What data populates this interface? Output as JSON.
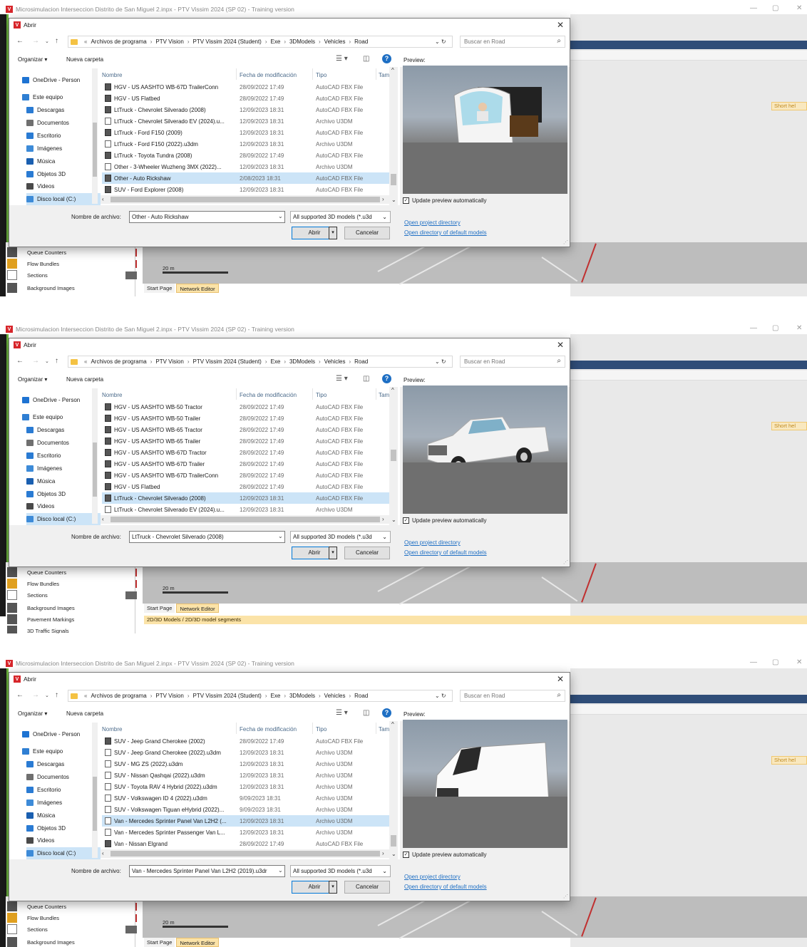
{
  "app": {
    "title": "Microsimulacion Interseccion Distrito de San Miguel 2.inpx - PTV Vissim 2024 (SP 02) - Training version",
    "short_help": "Short hel"
  },
  "dialog": {
    "title": "Abrir",
    "breadcrumb": [
      "Archivos de programa",
      "PTV Vision",
      "PTV Vissim 2024 (Student)",
      "Exe",
      "3DModels",
      "Vehicles",
      "Road"
    ],
    "search_placeholder": "Buscar en Road",
    "organize": "Organizar ▾",
    "new_folder": "Nueva carpeta",
    "preview_label": "Preview:",
    "columns": {
      "name": "Nombre",
      "date": "Fecha de modificación",
      "type": "Tipo",
      "size": "Tam"
    },
    "nav_items": [
      "OneDrive - Person",
      "Este equipo",
      "Descargas",
      "Documentos",
      "Escritorio",
      "Imágenes",
      "Música",
      "Objetos 3D",
      "Videos",
      "Disco local (C:)"
    ],
    "nav_colors": [
      "#1e73d2",
      "#2f7fd3",
      "#2a7bd3",
      "#6f6f6f",
      "#2a7bd3",
      "#3d8bd8",
      "#1a5fb0",
      "#2a7bd3",
      "#4a4a4a",
      "#3d8bd8"
    ],
    "update_preview": "Update preview automatically",
    "filename_label": "Nombre de archivo:",
    "filter": "All supported 3D models (*.u3d",
    "open_btn": "Abrir",
    "cancel_btn": "Cancelar",
    "link1": "Open project directory",
    "link2": "Open directory of default models"
  },
  "background": {
    "left_items": [
      "Queue Counters",
      "Flow Bundles",
      "Sections",
      "Background Images",
      "Pavement Markings",
      "3D Traffic Signals"
    ],
    "scale": "20 m",
    "tabs": [
      "Start Page",
      "Network Editor"
    ],
    "panel_tab": "2D/3D Models / 2D/3D model segments"
  },
  "panels": [
    {
      "filename": "Other - Auto Rickshaw",
      "preview_model": "Auto Rickshaw",
      "files": [
        {
          "name": "HGV - US AASHTO WB-67D TrailerConn",
          "date": "28/09/2022 17:49",
          "type": "AutoCAD FBX File",
          "fbx": true
        },
        {
          "name": "HGV - US Flatbed",
          "date": "28/09/2022 17:49",
          "type": "AutoCAD FBX File",
          "fbx": true
        },
        {
          "name": "LtTruck - Chevrolet Silverado (2008)",
          "date": "12/09/2023 18:31",
          "type": "AutoCAD FBX File",
          "fbx": true
        },
        {
          "name": "LtTruck - Chevrolet Silverado EV (2024).u...",
          "date": "12/09/2023 18:31",
          "type": "Archivo U3DM",
          "fbx": false
        },
        {
          "name": "LtTruck - Ford F150 (2009)",
          "date": "12/09/2023 18:31",
          "type": "AutoCAD FBX File",
          "fbx": true
        },
        {
          "name": "LtTruck - Ford F150 (2022).u3dm",
          "date": "12/09/2023 18:31",
          "type": "Archivo U3DM",
          "fbx": false
        },
        {
          "name": "LtTruck - Toyota Tundra (2008)",
          "date": "28/09/2022 17:49",
          "type": "AutoCAD FBX File",
          "fbx": true
        },
        {
          "name": "Other - 3-Wheeler Wuzheng 3MX (2022)...",
          "date": "12/09/2023 18:31",
          "type": "Archivo U3DM",
          "fbx": false
        },
        {
          "name": "Other - Auto Rickshaw",
          "date": "2/08/2023 18:31",
          "type": "AutoCAD FBX File",
          "fbx": true,
          "selected": true
        },
        {
          "name": "SUV - Ford Explorer (2008)",
          "date": "12/09/2023 18:31",
          "type": "AutoCAD FBX File",
          "fbx": true
        }
      ]
    },
    {
      "filename": "LtTruck - Chevrolet Silverado (2008)",
      "preview_model": "Pickup truck",
      "files": [
        {
          "name": "HGV - US AASHTO WB-50 Tractor",
          "date": "28/09/2022 17:49",
          "type": "AutoCAD FBX File",
          "fbx": true
        },
        {
          "name": "HGV - US AASHTO WB-50 Trailer",
          "date": "28/09/2022 17:49",
          "type": "AutoCAD FBX File",
          "fbx": true
        },
        {
          "name": "HGV - US AASHTO WB-65 Tractor",
          "date": "28/09/2022 17:49",
          "type": "AutoCAD FBX File",
          "fbx": true
        },
        {
          "name": "HGV - US AASHTO WB-65 Trailer",
          "date": "28/09/2022 17:49",
          "type": "AutoCAD FBX File",
          "fbx": true
        },
        {
          "name": "HGV - US AASHTO WB-67D Tractor",
          "date": "28/09/2022 17:49",
          "type": "AutoCAD FBX File",
          "fbx": true
        },
        {
          "name": "HGV - US AASHTO WB-67D Trailer",
          "date": "28/09/2022 17:49",
          "type": "AutoCAD FBX File",
          "fbx": true
        },
        {
          "name": "HGV - US AASHTO WB-67D TrailerConn",
          "date": "28/09/2022 17:49",
          "type": "AutoCAD FBX File",
          "fbx": true
        },
        {
          "name": "HGV - US Flatbed",
          "date": "28/09/2022 17:49",
          "type": "AutoCAD FBX File",
          "fbx": true
        },
        {
          "name": "LtTruck - Chevrolet Silverado (2008)",
          "date": "12/09/2023 18:31",
          "type": "AutoCAD FBX File",
          "fbx": true,
          "selected": true
        },
        {
          "name": "LtTruck - Chevrolet Silverado EV (2024).u...",
          "date": "12/09/2023 18:31",
          "type": "Archivo U3DM",
          "fbx": false
        }
      ]
    },
    {
      "filename": "Van - Mercedes Sprinter Panel Van L2H2 (2019).u3dr",
      "preview_model": "Van",
      "files": [
        {
          "name": "SUV - Jeep Grand Cherokee (2002)",
          "date": "28/09/2022 17:49",
          "type": "AutoCAD FBX File",
          "fbx": true
        },
        {
          "name": "SUV - Jeep Grand Cherokee (2022).u3dm",
          "date": "12/09/2023 18:31",
          "type": "Archivo U3DM",
          "fbx": false
        },
        {
          "name": "SUV - MG ZS (2022).u3dm",
          "date": "12/09/2023 18:31",
          "type": "Archivo U3DM",
          "fbx": false
        },
        {
          "name": "SUV - Nissan Qashqai (2022).u3dm",
          "date": "12/09/2023 18:31",
          "type": "Archivo U3DM",
          "fbx": false
        },
        {
          "name": "SUV - Toyota RAV 4 Hybrid (2022).u3dm",
          "date": "12/09/2023 18:31",
          "type": "Archivo U3DM",
          "fbx": false
        },
        {
          "name": "SUV - Volkswagen ID 4 (2022).u3dm",
          "date": "9/09/2023 18:31",
          "type": "Archivo U3DM",
          "fbx": false
        },
        {
          "name": "SUV - Volkswagen Tiguan eHybrid (2022)...",
          "date": "9/09/2023 18:31",
          "type": "Archivo U3DM",
          "fbx": false
        },
        {
          "name": "Van - Mercedes Sprinter Panel Van L2H2 (...",
          "date": "12/09/2023 18:31",
          "type": "Archivo U3DM",
          "fbx": false,
          "selected": true
        },
        {
          "name": "Van - Mercedes Sprinter Passenger Van L...",
          "date": "12/09/2023 18:31",
          "type": "Archivo U3DM",
          "fbx": false
        },
        {
          "name": "Van - Nissan Elgrand",
          "date": "28/09/2022 17:49",
          "type": "AutoCAD FBX File",
          "fbx": true
        }
      ]
    }
  ]
}
